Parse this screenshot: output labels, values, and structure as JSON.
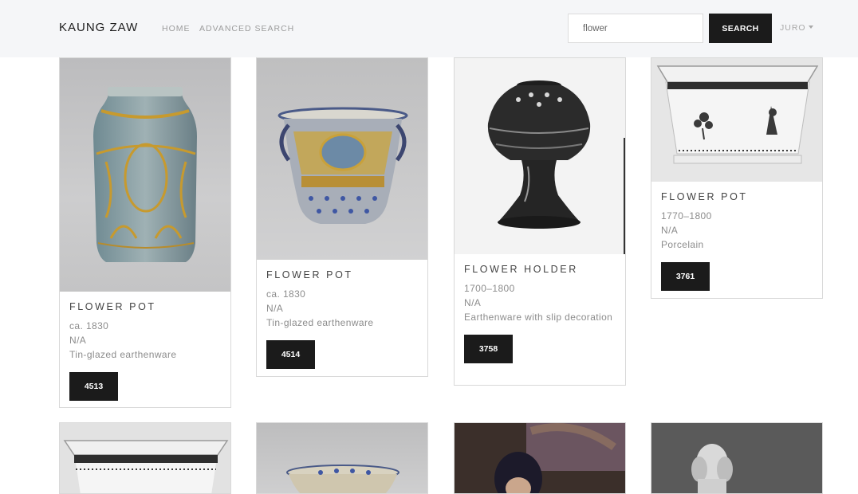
{
  "navbar": {
    "brand": "KAUNG ZAW",
    "links": [
      "HOME",
      "ADVANCED SEARCH"
    ],
    "search": {
      "value": "flower",
      "button_label": "SEARCH"
    },
    "user_menu": "JURO"
  },
  "cards": [
    {
      "title": "FLOWER POT",
      "date": "ca. 1830",
      "culture": "N/A",
      "medium": "Tin-glazed earthenware",
      "id": "4513"
    },
    {
      "title": "FLOWER POT",
      "date": "ca. 1830",
      "culture": "N/A",
      "medium": "Tin-glazed earthenware",
      "id": "4514"
    },
    {
      "title": "FLOWER HOLDER",
      "date": "1700–1800",
      "culture": "N/A",
      "medium": "Earthenware with slip decoration",
      "id": "3758"
    },
    {
      "title": "FLOWER POT",
      "date": "1770–1800",
      "culture": "N/A",
      "medium": "Porcelain",
      "id": "3761"
    }
  ],
  "colors": {
    "button": "#1b1b1b",
    "navbar_bg": "#f5f6f8",
    "card_border": "#d9d9d9"
  }
}
